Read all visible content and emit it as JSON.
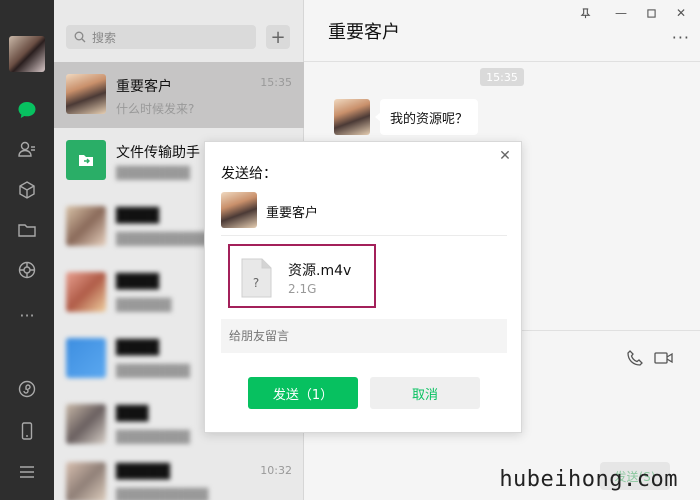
{
  "sidebar": {
    "avatar_icon": "user-avatar",
    "icons": [
      "chat-icon",
      "contacts-icon",
      "cube-icon",
      "folder-icon",
      "moments-icon",
      "more-dots-icon",
      "mini-program-icon",
      "phone-icon",
      "menu-icon"
    ]
  },
  "search": {
    "placeholder": "搜索"
  },
  "conversations": [
    {
      "name": "重要客户",
      "time": "15:35",
      "message": "什么时候发来?"
    },
    {
      "name": "文件传输助手",
      "time": "",
      "message": "████████"
    },
    {
      "name": "████",
      "time": "",
      "message": "██████████"
    },
    {
      "name": "████",
      "time": "",
      "message": "██████"
    },
    {
      "name": "████",
      "time": "",
      "message": "████████"
    },
    {
      "name": "███",
      "time": "",
      "message": "████████"
    },
    {
      "name": "█████",
      "time": "10:32",
      "message": "██████████"
    }
  ],
  "chat": {
    "title": "重要客户",
    "timestamp": "15:35",
    "message": "我的资源呢？",
    "send_label": "发送(S)"
  },
  "modal": {
    "title": "发送给：",
    "recipient": "重要客户",
    "file_name": "资源.m4v",
    "file_size": "2.1G",
    "file_icon_glyph": "?",
    "note_placeholder": "给朋友留言",
    "send_label": "发送（1）",
    "cancel_label": "取消",
    "close_glyph": "✕"
  },
  "watermark": "hubeihong.com",
  "colors": {
    "accent": "#07c160",
    "highlight_border": "#a3205a",
    "nav_bg": "#2e2e2e"
  }
}
